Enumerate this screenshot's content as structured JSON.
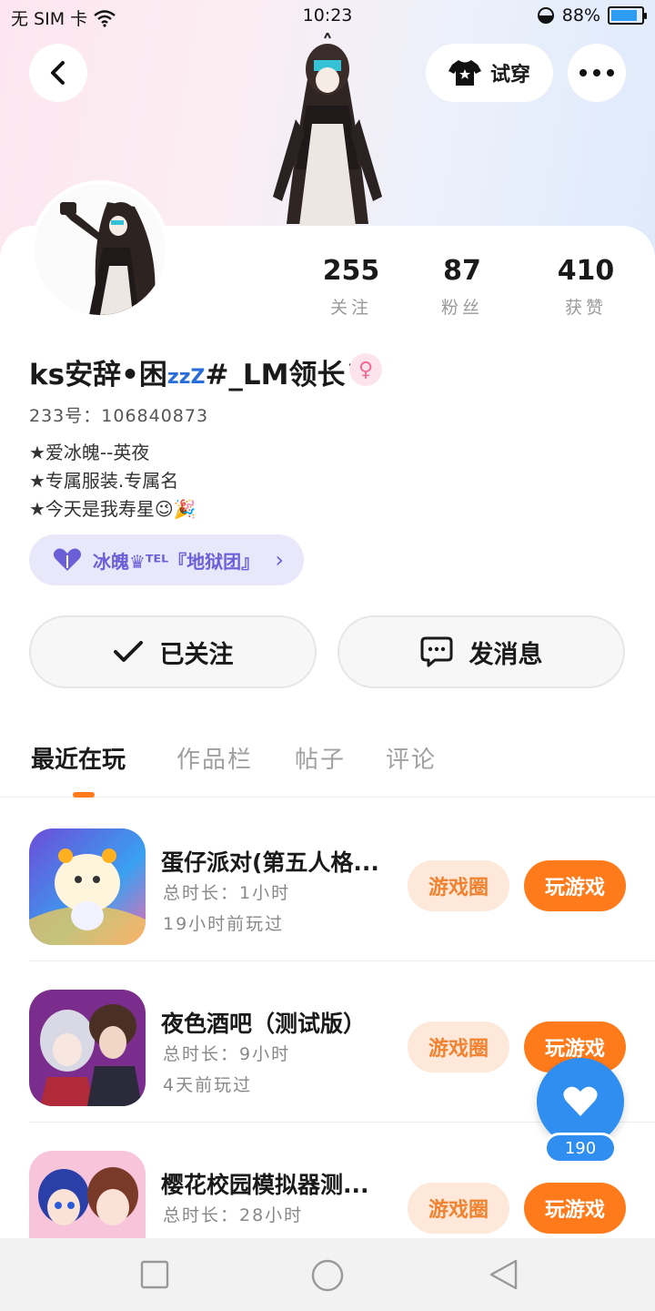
{
  "status_bar": {
    "carrier": "无 SIM 卡",
    "time": "10:23",
    "battery": "88%",
    "battery_level": 0.88
  },
  "header": {
    "tryon_label": "试穿"
  },
  "profile": {
    "stats": [
      {
        "value": "255",
        "label": "关注"
      },
      {
        "value": "87",
        "label": "粉丝"
      },
      {
        "value": "410",
        "label": "获赞"
      }
    ],
    "username": "ks安辞•困",
    "username_zzz": "zzZ",
    "username_suffix": "#_LM领长™",
    "gender_symbol": "♀",
    "uid": "233号：106840873",
    "bio_lines": [
      "★爱冰魄--英夜",
      "★专属服装.专属名",
      "★今天是我寿星😉🎉"
    ],
    "guild_label": "冰魄♛ᵀᴱᴸ『地狱团』"
  },
  "actions": {
    "follow_label": "已关注",
    "message_label": "发消息"
  },
  "tabs": [
    {
      "label": "最近在玩"
    },
    {
      "label": "作品栏"
    },
    {
      "label": "帖子"
    },
    {
      "label": "评论"
    }
  ],
  "games": [
    {
      "name": "蛋仔派对(第五人格...",
      "duration": "总时长：1小时",
      "last_played": "19小时前玩过",
      "circle_label": "游戏圈",
      "play_label": "玩游戏"
    },
    {
      "name": "夜色酒吧（测试版）",
      "duration": "总时长：9小时",
      "last_played": "4天前玩过",
      "circle_label": "游戏圈",
      "play_label": "玩游戏"
    },
    {
      "name": "樱花校园模拟器测...",
      "duration": "总时长：28小时",
      "last_played": "",
      "circle_label": "游戏圈",
      "play_label": "玩游戏"
    }
  ],
  "like_fab": {
    "count": "190"
  },
  "colors": {
    "accent": "#ff7a1a",
    "like_blue": "#2f8ef0",
    "guild_purple": "#6b5fd8"
  }
}
